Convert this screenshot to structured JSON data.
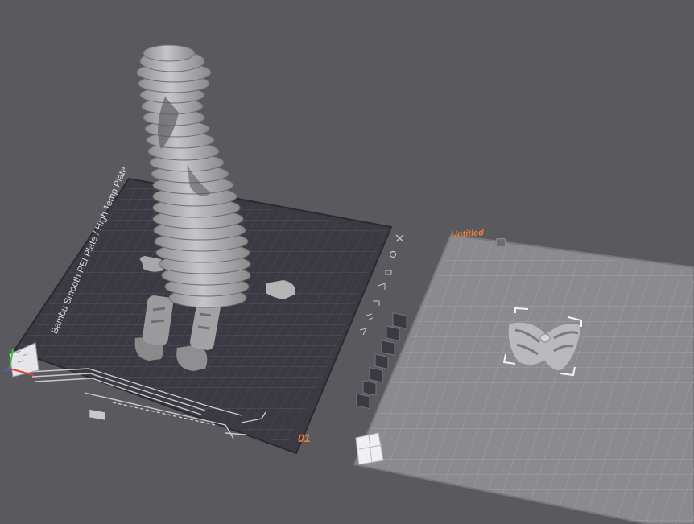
{
  "plates": [
    {
      "number": "01",
      "type_label": "Bambu Smooth PEI Plate / High Temp Plate"
    },
    {
      "name": "Untitled"
    }
  ],
  "colors": {
    "background": "#5a595e",
    "plate_dark": "#3b3a42",
    "plate_light": "#8a8a8f",
    "accent": "#ef7d3a",
    "model": "#b9b9bb"
  },
  "plate_toolbar": {
    "tools": [
      "close-icon",
      "settings-icon",
      "lock-icon",
      "orient-icon",
      "arrange-icon",
      "auto-rotate-icon",
      "add-plate-icon"
    ]
  },
  "models": [
    {
      "name": "layered-figure-model"
    },
    {
      "name": "small-part-model",
      "selected": true
    }
  ]
}
